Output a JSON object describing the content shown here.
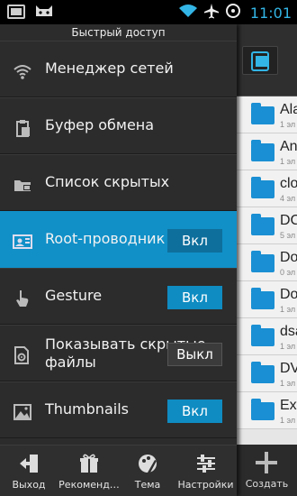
{
  "statusbar": {
    "left_icons": [
      "screen-icon",
      "cat-icon"
    ],
    "right_icons": [
      "wifi-icon",
      "airplane-icon",
      "cursor-circle-icon"
    ],
    "time": "11:01",
    "time_color": "#33b5e5"
  },
  "drawer": {
    "title": "Быстрый доступ",
    "items": [
      {
        "label": "Менеджер сетей",
        "icon": "wifi-icon"
      },
      {
        "label": "Буфер обмена",
        "icon": "clipboard-icon"
      },
      {
        "label": "Список скрытых",
        "icon": "hidden-folder-icon"
      },
      {
        "label": "Root-проводник",
        "icon": "root-icon",
        "toggle": "Вкл",
        "toggle_on": true,
        "active": true
      },
      {
        "label": "Gesture",
        "icon": "gesture-hand-icon",
        "toggle": "Вкл",
        "toggle_on": true
      },
      {
        "label": "Показывать скрытые файлы",
        "icon": "hidden-files-icon",
        "toggle": "Выкл",
        "toggle_on": false
      },
      {
        "label": "Thumbnails",
        "icon": "thumbnails-icon",
        "toggle": "Вкл",
        "toggle_on": true
      }
    ],
    "accent_color": "#1190c8"
  },
  "bottombar": {
    "items": [
      {
        "label": "Выход",
        "icon": "exit-icon"
      },
      {
        "label": "Рекоменд…",
        "icon": "gift-icon"
      },
      {
        "label": "Тема",
        "icon": "theme-palette-icon"
      },
      {
        "label": "Настройки",
        "icon": "settings-sliders-icon"
      }
    ]
  },
  "background_panel": {
    "files": [
      {
        "name": "Ala",
        "sub": "1 эл"
      },
      {
        "name": "An",
        "sub": "1 эл"
      },
      {
        "name": "clo",
        "sub": "4 эл"
      },
      {
        "name": "DC",
        "sub": "5 эл"
      },
      {
        "name": "Do",
        "sub": "0 эл"
      },
      {
        "name": "Do",
        "sub": "1 эл"
      },
      {
        "name": "dsa",
        "sub": "1 эл"
      },
      {
        "name": "DV",
        "sub": "1 эл"
      },
      {
        "name": "Ext",
        "sub": "1 эл"
      }
    ],
    "create_label": "Создать",
    "folder_color": "#1a8fd3"
  }
}
